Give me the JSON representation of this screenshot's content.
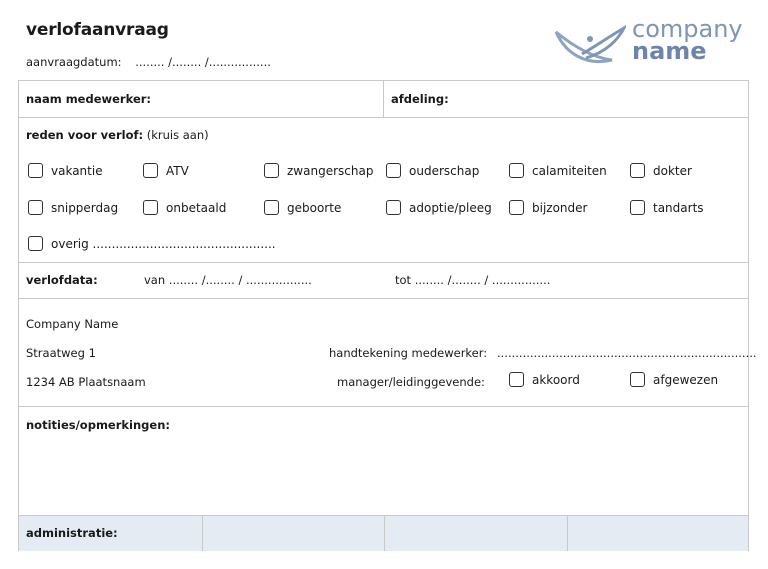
{
  "header": {
    "title": "verlofaanvraag",
    "request_date_label": "aanvraagdatum:",
    "request_date_placeholder": "........ /........ /................."
  },
  "logo": {
    "line1": "company",
    "line2": "name",
    "icon": "leaf-swoosh-icon",
    "colors": {
      "primary": "#7f95b6",
      "dark": "#6d85aa"
    }
  },
  "employee": {
    "name_label": "naam medewerker:",
    "department_label": "afdeling:"
  },
  "reason": {
    "label_bold": "reden voor verlof:",
    "label_hint": "(kruis aan)",
    "options": [
      "vakantie",
      "ATV",
      "zwangerschap",
      "ouderschap",
      "calamiteiten",
      "dokter",
      "snipperdag",
      "onbetaald",
      "geboorte",
      "adoptie/pleeg",
      "bijzonder",
      "tandarts",
      "overig ................................................"
    ]
  },
  "leave_dates": {
    "label": "verlofdata:",
    "from": "van ........ /........ / ..................",
    "to": "tot ........ /........ / ................"
  },
  "company": {
    "name": "Company Name",
    "street": "Straatweg 1",
    "city": "1234 AB Plaatsnaam"
  },
  "signature": {
    "employee_label": "handtekening medewerker:",
    "employee_line": ".......................................................................",
    "manager_label": "manager/leidinggevende:",
    "approved": "akkoord",
    "rejected": "afgewezen"
  },
  "notes": {
    "label": "notities/opmerkingen:"
  },
  "admin": {
    "label": "administratie:",
    "accent": "#e4ebf3"
  }
}
